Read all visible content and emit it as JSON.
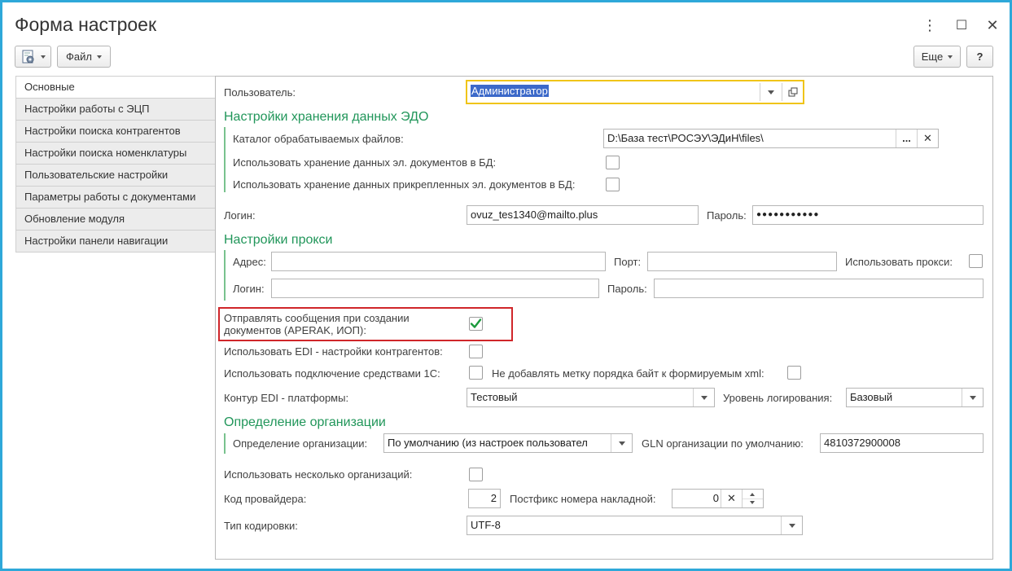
{
  "window": {
    "title": "Форма настроек",
    "menu_icon": "⋮",
    "maximize_icon": "☐",
    "close_icon": "✕"
  },
  "toolbar": {
    "settings_icon": "gear-doc-icon",
    "file_label": "Файл",
    "more_label": "Еще",
    "help_label": "?"
  },
  "tabs": [
    {
      "label": "Основные"
    },
    {
      "label": "Настройки работы с ЭЦП"
    },
    {
      "label": "Настройки поиска контрагентов"
    },
    {
      "label": "Настройки поиска номенклатуры"
    },
    {
      "label": "Пользовательские настройки"
    },
    {
      "label": "Параметры работы с документами"
    },
    {
      "label": "Обновление модуля"
    },
    {
      "label": "Настройки панели навигации"
    }
  ],
  "form": {
    "user_label": "Пользователь:",
    "user_value": "Администратор",
    "edo_section": "Настройки хранения данных ЭДО",
    "catalog_label": "Каталог обрабатываемых файлов:",
    "catalog_value": "D:\\База тест\\РОСЭУ\\ЭДиН\\files\\",
    "catalog_browse": "...",
    "catalog_clear": "✕",
    "store_db_label": "Использовать хранение данных эл. документов в БД:",
    "store_attached_label": "Использовать хранение данных прикрепленных эл. документов в БД:",
    "login_label": "Логин:",
    "login_value": "ovuz_tes1340@mailto.plus",
    "password_label": "Пароль:",
    "password_value": "●●●●●●●●●●●",
    "proxy_section": "Настройки прокси",
    "proxy_address_label": "Адрес:",
    "proxy_port_label": "Порт:",
    "proxy_use_label": "Использовать прокси:",
    "proxy_login_label": "Логин:",
    "proxy_password_label": "Пароль:",
    "send_messages_label_1": "Отправлять сообщения при создании",
    "send_messages_label_2": "документов (APERAK, ИОП):",
    "send_messages_checked": true,
    "edi_counterparty_label": "Использовать EDI - настройки контрагентов:",
    "connect_1c_label": "Использовать подключение средствами 1С:",
    "no_bom_label": "Не добавлять метку порядка байт к формируемым xml:",
    "edi_contour_label": "Контур EDI - платформы:",
    "edi_contour_value": "Тестовый",
    "log_level_label": "Уровень логирования:",
    "log_level_value": "Базовый",
    "org_section": "Определение организации",
    "org_def_label": "Определение организации:",
    "org_def_value": "По умолчанию (из настроек пользовател",
    "gln_label": "GLN организации по умолчанию:",
    "gln_value": "4810372900008",
    "multi_org_label": "Использовать несколько организаций:",
    "provider_code_label": "Код провайдера:",
    "provider_code_value": "2",
    "postfix_label": "Постфикс номера накладной:",
    "postfix_value": "0",
    "encoding_label": "Тип кодировки:",
    "encoding_value": "UTF-8"
  },
  "colors": {
    "accent_border": "#2ea8d9",
    "section_green": "#21965a",
    "highlight_red": "#d0262a",
    "focus_yellow": "#f0c419",
    "check_green": "#1a9a3c"
  }
}
